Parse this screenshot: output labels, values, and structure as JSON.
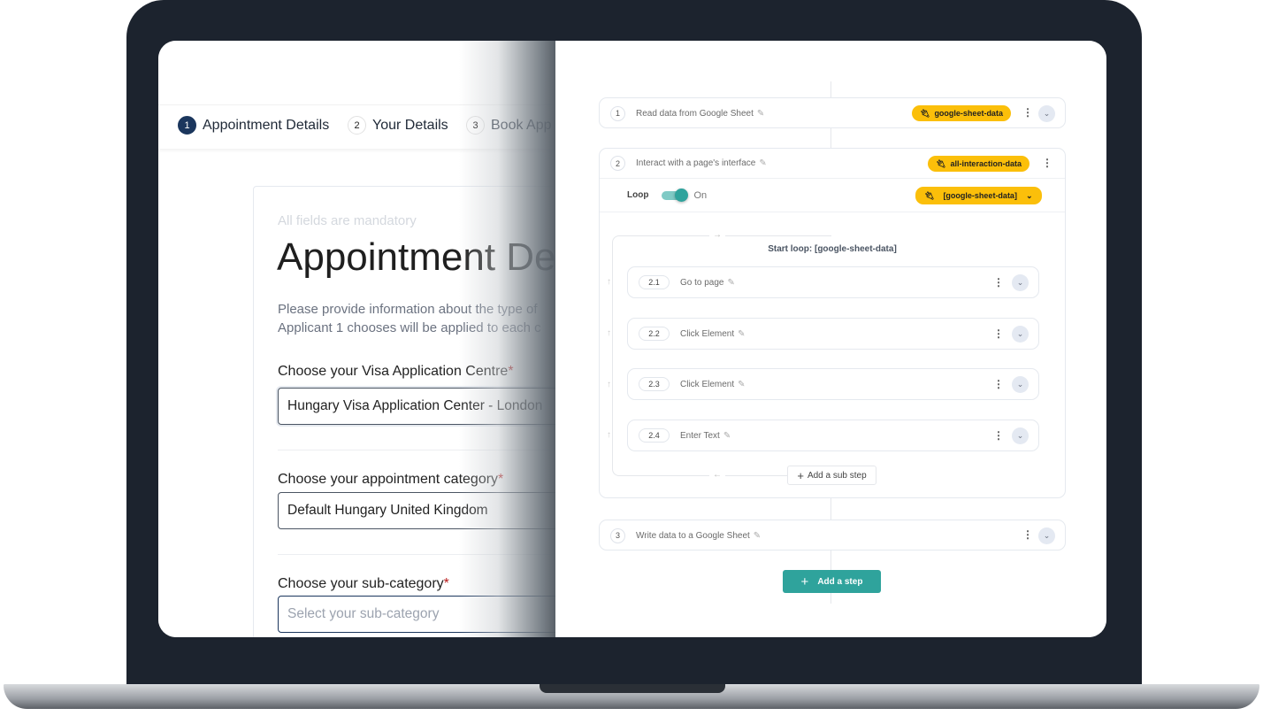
{
  "form": {
    "steps": [
      {
        "num": "1",
        "label": "Appointment Details"
      },
      {
        "num": "2",
        "label": "Your Details"
      },
      {
        "num": "3",
        "label": "Book App"
      }
    ],
    "mandatory_note": "All fields are mandatory",
    "heading": "Appointment De",
    "intro_line1": "Please provide information about the type of",
    "intro_line2": "Applicant 1 chooses will be applied to each c",
    "required_mark": "*",
    "fields": [
      {
        "label": "Choose your Visa Application Centre",
        "value": "Hungary Visa Application Center - London"
      },
      {
        "label": "Choose your appointment category",
        "value": "Default Hungary United Kingdom"
      },
      {
        "label": "Choose your sub-category",
        "placeholder": "Select your sub-category"
      }
    ]
  },
  "workflow": {
    "steps": [
      {
        "num": "1",
        "title": "Read data from Google Sheet",
        "chip": "google-sheet-data"
      },
      {
        "num": "2",
        "title": "Interact with a page's interface",
        "chip": "all-interaction-data"
      },
      {
        "num": "3",
        "title": "Write data to a Google Sheet"
      }
    ],
    "loop": {
      "label": "Loop",
      "state": "On",
      "enabled": true,
      "source": "[google-sheet-data]",
      "start_label": "Start loop: [google-sheet-data]"
    },
    "sub_steps": [
      {
        "num": "2.1",
        "title": "Go to page"
      },
      {
        "num": "2.2",
        "title": "Click Element"
      },
      {
        "num": "2.3",
        "title": "Click Element"
      },
      {
        "num": "2.4",
        "title": "Enter Text"
      }
    ],
    "add_sub_step": "Add a sub step",
    "add_step": "Add a step"
  },
  "colors": {
    "accent": "#2fa39c",
    "chip": "#fbbf0a",
    "navy": "#1b365d"
  }
}
